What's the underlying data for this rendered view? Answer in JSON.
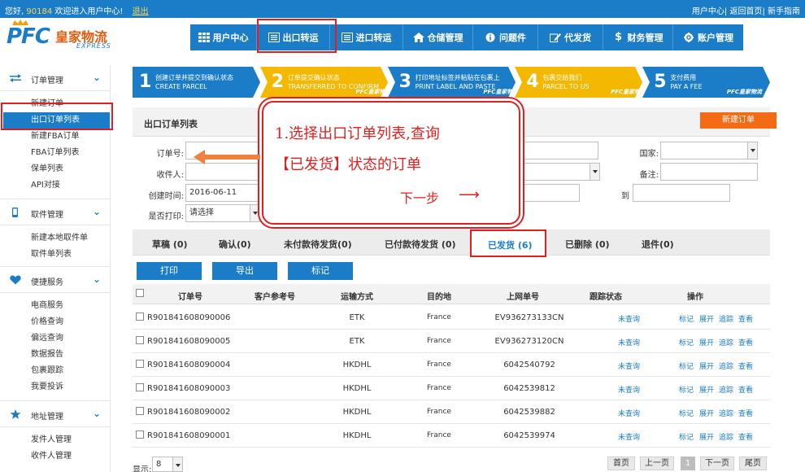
{
  "topbar": {
    "greeting": "您好,",
    "user_id": "90184",
    "welcome": "欢迎进入用户中心!",
    "logout": "退出",
    "right_links": "用户中心| 返回首页| 新手指南"
  },
  "logo": {
    "brand": "PFC",
    "name_cn": "皇家物流",
    "name_en": "EXPRESS"
  },
  "nav": {
    "items": [
      {
        "label": "用户中心",
        "icon": "grid-icon"
      },
      {
        "label": "出口转运",
        "icon": "list-icon"
      },
      {
        "label": "进口转运",
        "icon": "list-icon"
      },
      {
        "label": "仓储管理",
        "icon": "home-icon"
      },
      {
        "label": "问题件",
        "icon": "info-icon"
      },
      {
        "label": "代发货",
        "icon": "pencil-icon"
      },
      {
        "label": "财务管理",
        "icon": "dollar-icon"
      },
      {
        "label": "账户管理",
        "icon": "gear-icon"
      }
    ]
  },
  "sidebar": {
    "groups": [
      {
        "title": "订单管理",
        "icon": "arrows-icon",
        "items": [
          "新建订单",
          "出口订单列表",
          "新建FBA订单",
          "FBA订单列表",
          "保单列表",
          "API对接"
        ]
      },
      {
        "title": "取件管理",
        "icon": "phone-icon",
        "items": [
          "新建本地取件单",
          "取件单列表"
        ]
      },
      {
        "title": "便捷服务",
        "icon": "heart-icon",
        "items": [
          "电商服务",
          "价格查询",
          "偏远查询",
          "数据报告",
          "包裹跟踪",
          "我要投诉"
        ]
      },
      {
        "title": "地址管理",
        "icon": "star-icon",
        "items": [
          "发件人管理",
          "收件人管理"
        ]
      }
    ],
    "active_item": "出口订单列表"
  },
  "steps": [
    {
      "num": "1",
      "cn": "创建订单并提交到确认状态",
      "en": "CREATE PARCEL"
    },
    {
      "num": "2",
      "cn": "订单提交确认状态",
      "en": "TRANSFERRED TO CONFIRM"
    },
    {
      "num": "3",
      "cn": "打印地址标签并粘贴在包裹上",
      "en": "PRINT LABEL AND PASTE"
    },
    {
      "num": "4",
      "cn": "包裹交给我们",
      "en": "PARCEL TO US"
    },
    {
      "num": "5",
      "cn": "支付费用",
      "en": "PAY A FEE"
    }
  ],
  "step_tag": "PFC皇家物流",
  "panel": {
    "title": "出口订单列表",
    "new_order": "新建订单"
  },
  "filters": {
    "order_no": "订单号:",
    "recipient": "收件人:",
    "created": "创建时间:",
    "created_value": "2016-06-11",
    "printed": "是否打印:",
    "printed_value": "请选择",
    "country": "国家:",
    "remark": "备注:",
    "to": "到"
  },
  "annotation": {
    "line1": "1.选择出口订单列表,查询",
    "line2": "【已发货】状态的订单",
    "line3": "下一步",
    "arrow": "⟶"
  },
  "tabs": [
    {
      "label": "草稿 (0)"
    },
    {
      "label": "确认(0)"
    },
    {
      "label": "未付款待发货(0)"
    },
    {
      "label": "已付款待发货 (0)"
    },
    {
      "label": "已发货 (6)"
    },
    {
      "label": "已删除 (0)"
    },
    {
      "label": "退件(0)"
    }
  ],
  "actions": {
    "print": "打印",
    "export": "导出",
    "mark": "标记"
  },
  "table": {
    "headers": [
      "订单号",
      "客户参考号",
      "运输方式",
      "目的地",
      "上网单号",
      "跟踪状态",
      "操作"
    ],
    "rows": [
      {
        "order": "R901841608090006",
        "ref": "",
        "method": "ETK",
        "dest": "France",
        "track_no": "EV936273133CN",
        "status": "未查询"
      },
      {
        "order": "R901841608090005",
        "ref": "",
        "method": "ETK",
        "dest": "France",
        "track_no": "EV936273120CN",
        "status": "未查询"
      },
      {
        "order": "R901841608090004",
        "ref": "",
        "method": "HKDHL",
        "dest": "France",
        "track_no": "6042540792",
        "status": "未查询"
      },
      {
        "order": "R901841608090003",
        "ref": "",
        "method": "HKDHL",
        "dest": "France",
        "track_no": "6042539812",
        "status": "未查询"
      },
      {
        "order": "R901841608090002",
        "ref": "",
        "method": "HKDHL",
        "dest": "France",
        "track_no": "6042539882",
        "status": "未查询"
      },
      {
        "order": "R901841608090001",
        "ref": "",
        "method": "HKDHL",
        "dest": "France",
        "track_no": "6042539974",
        "status": "未查询"
      }
    ],
    "ops": [
      "标记",
      "展开",
      "追踪",
      "查看"
    ]
  },
  "footer": {
    "show_label": "显示:",
    "show_value": "8",
    "pager": [
      "首页",
      "上一页",
      "1",
      "下一页",
      "尾页"
    ]
  },
  "colors": {
    "primary": "#1b7cc8",
    "accent": "#f56a14",
    "highlight": "#e02020",
    "step_active": "#f5b800"
  }
}
